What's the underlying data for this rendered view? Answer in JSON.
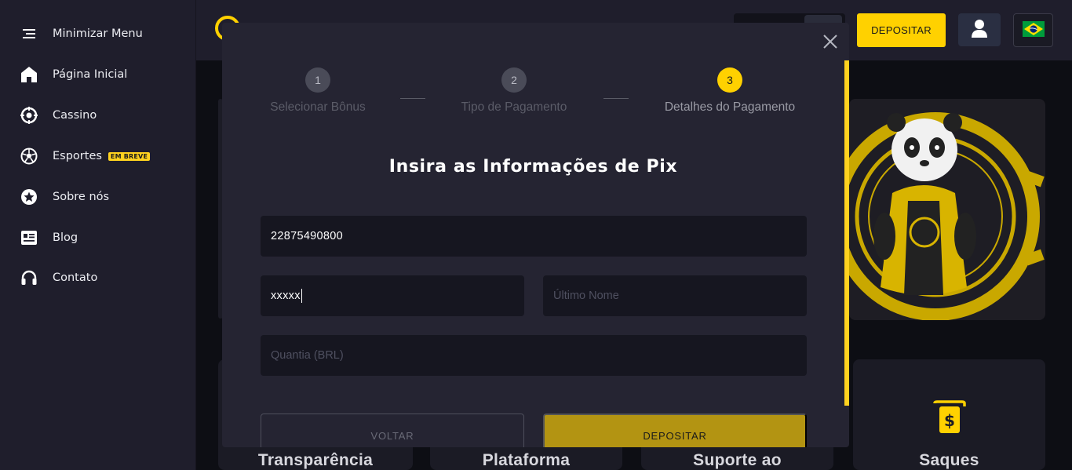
{
  "sidebar": {
    "items": [
      {
        "label": "Minimizar Menu",
        "icon": "menu-icon"
      },
      {
        "label": "Página Inicial",
        "icon": "home-icon"
      },
      {
        "label": "Cassino",
        "icon": "casino-chip-icon"
      },
      {
        "label": "Esportes",
        "icon": "soccer-ball-icon",
        "badge": "EM BREVE"
      },
      {
        "label": "Sobre nós",
        "icon": "star-icon"
      },
      {
        "label": "Blog",
        "icon": "newspaper-icon"
      },
      {
        "label": "Contato",
        "icon": "headset-icon"
      }
    ]
  },
  "header": {
    "deposit_label": "DEPOSITAR",
    "user_icon": "user-icon",
    "flag": "brazil-flag"
  },
  "background": {
    "categories": [
      "Transparência",
      "Plataforma",
      "Suporte ao",
      "Saques"
    ]
  },
  "modal": {
    "steps": [
      {
        "number": "1",
        "label": "Selecionar Bônus"
      },
      {
        "number": "2",
        "label": "Tipo de Pagamento"
      },
      {
        "number": "3",
        "label": "Detalhes do Pagamento"
      }
    ],
    "title": "Insira as Informações de Pix",
    "fields": {
      "pix_key": {
        "value": "22875490800"
      },
      "first_name": {
        "value": "xxxxx"
      },
      "last_name": {
        "placeholder": "Último Nome"
      },
      "amount": {
        "placeholder": "Quantia (BRL)"
      }
    },
    "back_label": "VOLTAR",
    "deposit_label": "DEPOSITAR"
  },
  "colors": {
    "accent": "#ffd100",
    "sidebar_bg": "#1f1e2c",
    "modal_bg": "#252432",
    "input_bg": "#161620"
  }
}
